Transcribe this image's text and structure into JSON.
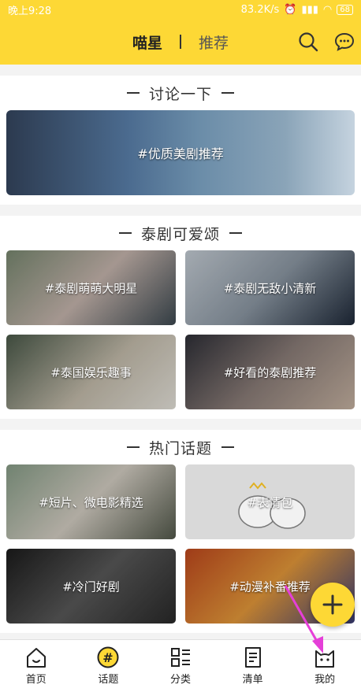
{
  "status": {
    "time": "晚上9:28",
    "speed": "83.2K/s",
    "battery": "68"
  },
  "header": {
    "tab_active": "喵星",
    "tab_inactive": "推荐"
  },
  "sections": {
    "discuss": {
      "title": "讨论一下",
      "banner": "#优质美剧推荐"
    },
    "thai": {
      "title": "泰剧可爱颂",
      "tiles": [
        {
          "label": "#泰剧萌萌大明星"
        },
        {
          "label": "#泰剧无敌小清新"
        },
        {
          "label": "#泰国娱乐趣事"
        },
        {
          "label": "#好看的泰剧推荐"
        }
      ]
    },
    "hot": {
      "title": "热门话题",
      "tiles": [
        {
          "label": "#短片、微电影精选"
        },
        {
          "label": "#表情包"
        },
        {
          "label": "#冷门好剧"
        },
        {
          "label": "#动漫补番推荐"
        }
      ]
    }
  },
  "nav": {
    "home": "首页",
    "topics": "话题",
    "category": "分类",
    "list": "清单",
    "mine": "我的"
  },
  "colors": {
    "brand_yellow": "#fdd835",
    "arrow": "#e53fd8"
  }
}
